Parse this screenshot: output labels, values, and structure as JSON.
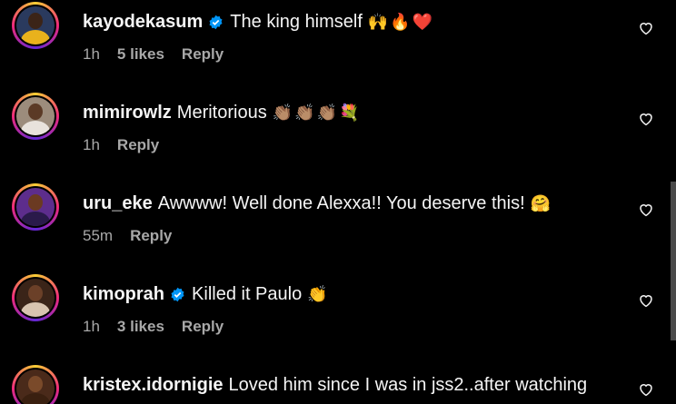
{
  "comments": [
    {
      "username": "kayodekasum",
      "verified": true,
      "text": "The king himself",
      "emojis": "🙌🔥❤️",
      "time": "1h",
      "likes": "5 likes",
      "reply": "Reply",
      "avatar_bg": "#2a3a5e",
      "avatar_head": "#3b2418",
      "avatar_body": "#e9b21c"
    },
    {
      "username": "mimirowlz",
      "verified": false,
      "text": "Meritorious",
      "emojis": "👏🏽👏🏽👏🏽💐",
      "time": "1h",
      "likes": "",
      "reply": "Reply",
      "avatar_bg": "#9c8c7c",
      "avatar_head": "#5b3a26",
      "avatar_body": "#e8e2dc"
    },
    {
      "username": "uru_eke",
      "verified": false,
      "text": "Awwww! Well done Alexxa!! You deserve this!",
      "emojis": "🤗",
      "time": "55m",
      "likes": "",
      "reply": "Reply",
      "avatar_bg": "#5d2d8c",
      "avatar_head": "#6b3a22",
      "avatar_body": "#2a1a4a"
    },
    {
      "username": "kimoprah",
      "verified": true,
      "text": "Killed it Paulo",
      "emojis": "👏",
      "time": "1h",
      "likes": "3 likes",
      "reply": "Reply",
      "avatar_bg": "#3a2418",
      "avatar_head": "#6b4028",
      "avatar_body": "#d8c4b0"
    },
    {
      "username": "kristex.idornigie",
      "verified": false,
      "text": "Loved him since I was in jss2..after watching",
      "emojis": "",
      "time": "",
      "likes": "",
      "reply": "",
      "avatar_bg": "#4a2a1a",
      "avatar_head": "#7a4a2a",
      "avatar_body": "#3a2010"
    }
  ],
  "colors": {
    "background": "#000000",
    "text_primary": "#f5f5f5",
    "text_secondary": "#a8a8a8",
    "verified_blue": "#0095f6"
  },
  "icons": {
    "like": "heart-outline-icon",
    "verified": "verified-badge-icon"
  }
}
